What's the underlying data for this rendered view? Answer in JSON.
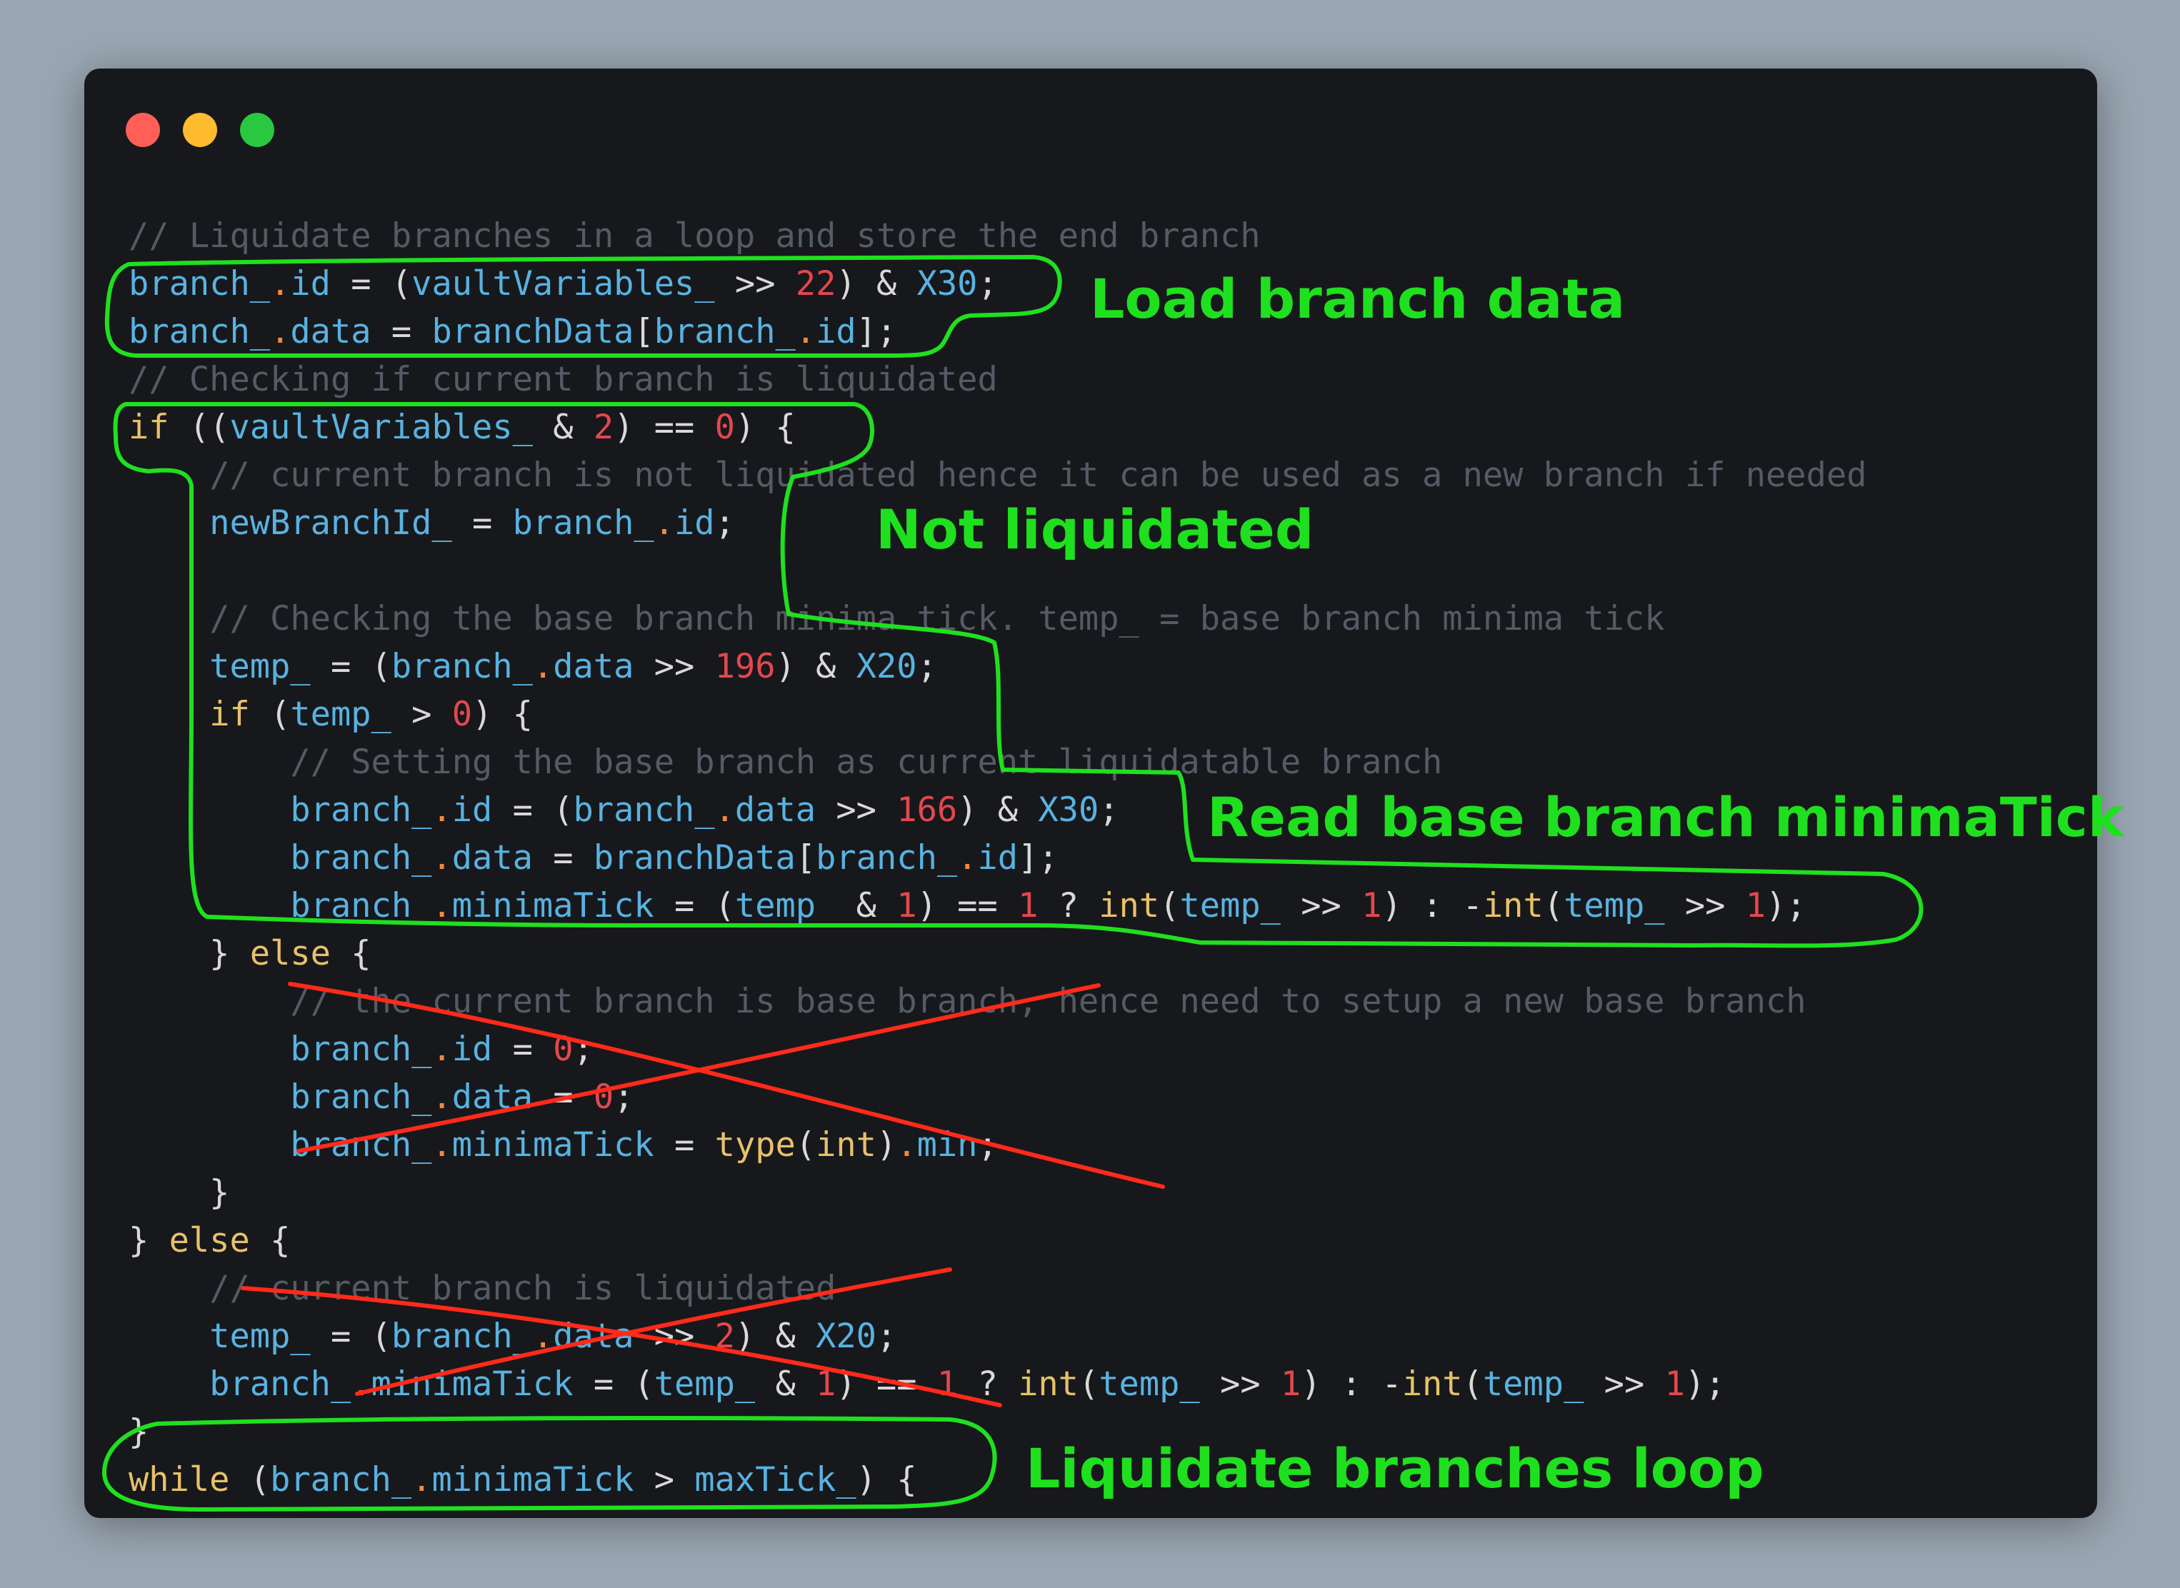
{
  "window": {
    "controls": [
      {
        "name": "close",
        "color": "#ff5f57"
      },
      {
        "name": "minimize",
        "color": "#febc2e"
      },
      {
        "name": "maximize",
        "color": "#28c840"
      }
    ]
  },
  "code": [
    [
      [
        "comment",
        "// Liquidate branches in a loop and store the end branch"
      ]
    ],
    [
      [
        "id",
        "branch_"
      ],
      [
        "prop",
        "."
      ],
      [
        "id",
        "id"
      ],
      [
        "op",
        " = ("
      ],
      [
        "id",
        "vaultVariables_"
      ],
      [
        "op",
        " >> "
      ],
      [
        "num",
        "22"
      ],
      [
        "op",
        ") & "
      ],
      [
        "id",
        "X30"
      ],
      [
        "punc",
        ";"
      ]
    ],
    [
      [
        "id",
        "branch_"
      ],
      [
        "prop",
        "."
      ],
      [
        "id",
        "data"
      ],
      [
        "op",
        " = "
      ],
      [
        "id",
        "branchData"
      ],
      [
        "punc",
        "["
      ],
      [
        "id",
        "branch_"
      ],
      [
        "prop",
        "."
      ],
      [
        "id",
        "id"
      ],
      [
        "punc",
        "];"
      ]
    ],
    [
      [
        "comment",
        "// Checking if current branch is liquidated"
      ]
    ],
    [
      [
        "kw",
        "if"
      ],
      [
        "op",
        " (("
      ],
      [
        "id",
        "vaultVariables_"
      ],
      [
        "op",
        " & "
      ],
      [
        "num",
        "2"
      ],
      [
        "op",
        ") == "
      ],
      [
        "num",
        "0"
      ],
      [
        "op",
        ") {"
      ]
    ],
    [
      [
        "op",
        "    "
      ],
      [
        "comment",
        "// current branch is not liquidated hence it can be used as a new branch if needed"
      ]
    ],
    [
      [
        "op",
        "    "
      ],
      [
        "id",
        "newBranchId_"
      ],
      [
        "op",
        " = "
      ],
      [
        "id",
        "branch_"
      ],
      [
        "prop",
        "."
      ],
      [
        "id",
        "id"
      ],
      [
        "punc",
        ";"
      ]
    ],
    [],
    [
      [
        "op",
        "    "
      ],
      [
        "comment",
        "// Checking the base branch minima tick. temp_ = base branch minima tick"
      ]
    ],
    [
      [
        "op",
        "    "
      ],
      [
        "id",
        "temp_"
      ],
      [
        "op",
        " = ("
      ],
      [
        "id",
        "branch_"
      ],
      [
        "prop",
        "."
      ],
      [
        "id",
        "data"
      ],
      [
        "op",
        " >> "
      ],
      [
        "num",
        "196"
      ],
      [
        "op",
        ") & "
      ],
      [
        "id",
        "X20"
      ],
      [
        "punc",
        ";"
      ]
    ],
    [
      [
        "op",
        "    "
      ],
      [
        "kw",
        "if"
      ],
      [
        "op",
        " ("
      ],
      [
        "id",
        "temp_"
      ],
      [
        "op",
        " > "
      ],
      [
        "num",
        "0"
      ],
      [
        "op",
        ") {"
      ]
    ],
    [
      [
        "op",
        "        "
      ],
      [
        "comment",
        "// Setting the base branch as current liquidatable branch"
      ]
    ],
    [
      [
        "op",
        "        "
      ],
      [
        "id",
        "branch_"
      ],
      [
        "prop",
        "."
      ],
      [
        "id",
        "id"
      ],
      [
        "op",
        " = ("
      ],
      [
        "id",
        "branch_"
      ],
      [
        "prop",
        "."
      ],
      [
        "id",
        "data"
      ],
      [
        "op",
        " >> "
      ],
      [
        "num",
        "166"
      ],
      [
        "op",
        ") & "
      ],
      [
        "id",
        "X30"
      ],
      [
        "punc",
        ";"
      ]
    ],
    [
      [
        "op",
        "        "
      ],
      [
        "id",
        "branch_"
      ],
      [
        "prop",
        "."
      ],
      [
        "id",
        "data"
      ],
      [
        "op",
        " = "
      ],
      [
        "id",
        "branchData"
      ],
      [
        "punc",
        "["
      ],
      [
        "id",
        "branch_"
      ],
      [
        "prop",
        "."
      ],
      [
        "id",
        "id"
      ],
      [
        "punc",
        "];"
      ]
    ],
    [
      [
        "op",
        "        "
      ],
      [
        "id",
        "branch_"
      ],
      [
        "prop",
        "."
      ],
      [
        "id",
        "minimaTick"
      ],
      [
        "op",
        " = ("
      ],
      [
        "id",
        "temp_"
      ],
      [
        "op",
        " & "
      ],
      [
        "num",
        "1"
      ],
      [
        "op",
        ") == "
      ],
      [
        "num",
        "1"
      ],
      [
        "op",
        " ? "
      ],
      [
        "fn",
        "int"
      ],
      [
        "op",
        "("
      ],
      [
        "id",
        "temp_"
      ],
      [
        "op",
        " >> "
      ],
      [
        "num",
        "1"
      ],
      [
        "op",
        ") : -"
      ],
      [
        "fn",
        "int"
      ],
      [
        "op",
        "("
      ],
      [
        "id",
        "temp_"
      ],
      [
        "op",
        " >> "
      ],
      [
        "num",
        "1"
      ],
      [
        "op",
        ");"
      ]
    ],
    [
      [
        "op",
        "    } "
      ],
      [
        "kw",
        "else"
      ],
      [
        "op",
        " {"
      ]
    ],
    [
      [
        "op",
        "        "
      ],
      [
        "comment",
        "// the current branch is base branch, hence need to setup a new base branch"
      ]
    ],
    [
      [
        "op",
        "        "
      ],
      [
        "id",
        "branch_"
      ],
      [
        "prop",
        "."
      ],
      [
        "id",
        "id"
      ],
      [
        "op",
        " = "
      ],
      [
        "num",
        "0"
      ],
      [
        "punc",
        ";"
      ]
    ],
    [
      [
        "op",
        "        "
      ],
      [
        "id",
        "branch_"
      ],
      [
        "prop",
        "."
      ],
      [
        "id",
        "data"
      ],
      [
        "op",
        " = "
      ],
      [
        "num",
        "0"
      ],
      [
        "punc",
        ";"
      ]
    ],
    [
      [
        "op",
        "        "
      ],
      [
        "id",
        "branch_"
      ],
      [
        "prop",
        "."
      ],
      [
        "id",
        "minimaTick"
      ],
      [
        "op",
        " = "
      ],
      [
        "fn",
        "type"
      ],
      [
        "op",
        "("
      ],
      [
        "fn",
        "int"
      ],
      [
        "op",
        ")"
      ],
      [
        "prop",
        "."
      ],
      [
        "id",
        "min"
      ],
      [
        "punc",
        ";"
      ]
    ],
    [
      [
        "op",
        "    }"
      ]
    ],
    [
      [
        "op",
        "} "
      ],
      [
        "kw",
        "else"
      ],
      [
        "op",
        " {"
      ]
    ],
    [
      [
        "op",
        "    "
      ],
      [
        "comment",
        "// current branch is liquidated"
      ]
    ],
    [
      [
        "op",
        "    "
      ],
      [
        "id",
        "temp_"
      ],
      [
        "op",
        " = ("
      ],
      [
        "id",
        "branch_"
      ],
      [
        "prop",
        "."
      ],
      [
        "id",
        "data"
      ],
      [
        "op",
        " >> "
      ],
      [
        "num",
        "2"
      ],
      [
        "op",
        ") & "
      ],
      [
        "id",
        "X20"
      ],
      [
        "punc",
        ";"
      ]
    ],
    [
      [
        "op",
        "    "
      ],
      [
        "id",
        "branch_"
      ],
      [
        "prop",
        "."
      ],
      [
        "id",
        "minimaTick"
      ],
      [
        "op",
        " = ("
      ],
      [
        "id",
        "temp_"
      ],
      [
        "op",
        " & "
      ],
      [
        "num",
        "1"
      ],
      [
        "op",
        ") == "
      ],
      [
        "num",
        "1"
      ],
      [
        "op",
        " ? "
      ],
      [
        "fn",
        "int"
      ],
      [
        "op",
        "("
      ],
      [
        "id",
        "temp_"
      ],
      [
        "op",
        " >> "
      ],
      [
        "num",
        "1"
      ],
      [
        "op",
        ") : -"
      ],
      [
        "fn",
        "int"
      ],
      [
        "op",
        "("
      ],
      [
        "id",
        "temp_"
      ],
      [
        "op",
        " >> "
      ],
      [
        "num",
        "1"
      ],
      [
        "op",
        ");"
      ]
    ],
    [
      [
        "op",
        "}"
      ]
    ],
    [
      [
        "kw",
        "while"
      ],
      [
        "op",
        " ("
      ],
      [
        "id",
        "branch_"
      ],
      [
        "prop",
        "."
      ],
      [
        "id",
        "minimaTick"
      ],
      [
        "op",
        " > "
      ],
      [
        "id",
        "maxTick_"
      ],
      [
        "op",
        ") {"
      ]
    ]
  ],
  "annotations": {
    "load_branch_data": "Load branch data",
    "not_liquidated": "Not liquidated",
    "read_base_minima": "Read base branch minimaTick",
    "liquidate_loop": "Liquidate branches loop"
  },
  "colors": {
    "annotation_green": "#1fe01f",
    "strike_red": "#ff2a1a",
    "background": "#17181b"
  }
}
